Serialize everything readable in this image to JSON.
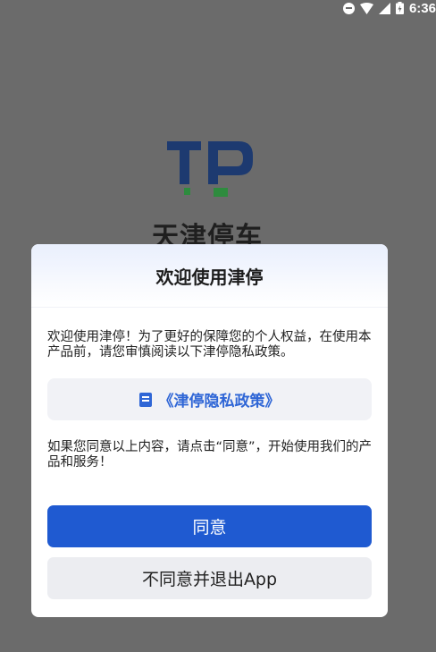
{
  "status_bar": {
    "time": "6:36"
  },
  "splash": {
    "brand_name": "天津停车"
  },
  "dialog": {
    "title": "欢迎使用津停",
    "intro_text": "欢迎使用津停！为了更好的保障您的个人权益，在使用本产品前，请您审慎阅读以下津停隐私政策。",
    "policy_link_label": "《津停隐私政策》",
    "consent_text": "如果您同意以上内容，请点击“同意”，开始使用我们的产品和服务！",
    "agree_button": "同意",
    "decline_button": "不同意并退出App"
  },
  "colors": {
    "primary": "#1f5ad1",
    "link": "#2f66d6",
    "overlay": "#6b6b6b",
    "logo_navy": "#1d3a70",
    "logo_green": "#2e8b3e"
  }
}
